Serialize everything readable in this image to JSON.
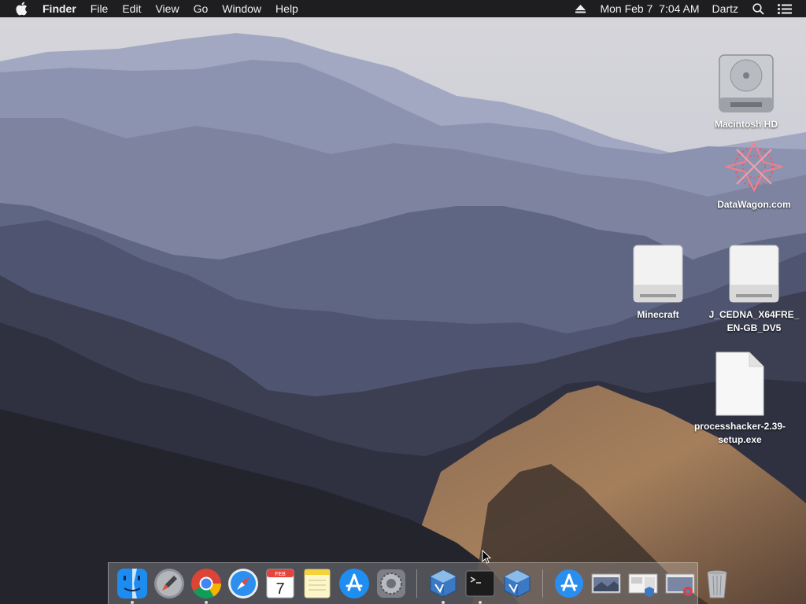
{
  "menubar": {
    "app_name": "Finder",
    "menus": [
      "File",
      "Edit",
      "View",
      "Go",
      "Window",
      "Help"
    ],
    "clock": "Mon Feb 7  7:04 AM",
    "user": "Dartz",
    "icons": [
      "apple-icon",
      "eject-icon",
      "spotlight-search-icon",
      "notification-center-icon"
    ]
  },
  "desktop_icons": [
    {
      "label": "Macintosh HD",
      "icon": "hard-drive-icon"
    },
    {
      "label": "DataWagon.com",
      "icon": "datawagon-logo-icon"
    },
    {
      "label": "Minecraft",
      "icon": "external-drive-icon"
    },
    {
      "label": "J_CEDNA_X64FRE_EN-GB_DV5",
      "icon": "external-drive-icon"
    },
    {
      "label": "processhacker-2.39-setup.exe",
      "icon": "document-icon"
    }
  ],
  "calendar_icon": {
    "month": "FEB",
    "day": "7"
  },
  "dock": {
    "apps": [
      {
        "name": "Finder",
        "icon": "finder-icon",
        "running": true
      },
      {
        "name": "Launchpad",
        "icon": "launchpad-icon",
        "running": false
      },
      {
        "name": "Google Chrome",
        "icon": "chrome-icon",
        "running": true
      },
      {
        "name": "Safari",
        "icon": "safari-icon",
        "running": false
      },
      {
        "name": "Calendar",
        "icon": "calendar-icon",
        "running": false
      },
      {
        "name": "Notes",
        "icon": "notes-icon",
        "running": false
      },
      {
        "name": "App Store",
        "icon": "app-store-icon",
        "running": false
      },
      {
        "name": "System Preferences",
        "icon": "system-preferences-icon",
        "running": false
      },
      {
        "name": "VirtualBox",
        "icon": "virtualbox-icon",
        "running": true
      },
      {
        "name": "Terminal",
        "icon": "terminal-icon",
        "running": true
      },
      {
        "name": "VirtualBox VM",
        "icon": "virtualbox-icon",
        "running": false
      }
    ],
    "others": [
      {
        "name": "Applications",
        "icon": "applications-folder-icon"
      },
      {
        "name": "Minimized window 1",
        "icon": "window-thumbnail-icon"
      },
      {
        "name": "Minimized window 2",
        "icon": "window-thumbnail-icon"
      },
      {
        "name": "Minimized window 3",
        "icon": "window-thumbnail-icon"
      },
      {
        "name": "Trash",
        "icon": "trash-icon"
      }
    ]
  },
  "colors": {
    "menubar_bg": "#1e1e20",
    "dock_bg": "rgba(235,235,240,0.22)"
  }
}
